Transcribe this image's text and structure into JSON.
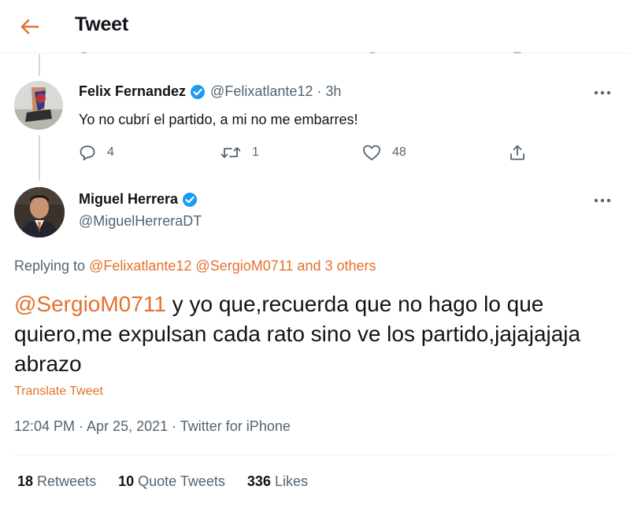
{
  "header": {
    "title": "Tweet",
    "back_icon": "back-arrow-icon"
  },
  "accent_color": "#e4712d",
  "reply_tweet": {
    "name": "Felix Fernandez",
    "handle": "@Felixatlante12",
    "time": "· 3h",
    "text": "Yo no cubrí el partido, a mi no me embarres!",
    "replies": "4",
    "retweets": "1",
    "likes": "48"
  },
  "main_tweet": {
    "name": "Miguel Herrera",
    "handle": "@MiguelHerreraDT",
    "replying_prefix": "Replying to",
    "replying_mentions": "@Felixatlante12 @SergioM0711 and 3 others",
    "mention": "@SergioM0711",
    "text": " y yo que,recuerda que no hago lo que quiero,me expulsan cada rato sino ve los partido,jajajajaja abrazo",
    "translate": "Translate Tweet",
    "timestamp": "12:04 PM · Apr 25, 2021 · Twitter for iPhone"
  },
  "stats": {
    "retweets_count": "18",
    "retweets_label": "Retweets",
    "quotes_count": "10",
    "quotes_label": "Quote Tweets",
    "likes_count": "336",
    "likes_label": "Likes"
  }
}
